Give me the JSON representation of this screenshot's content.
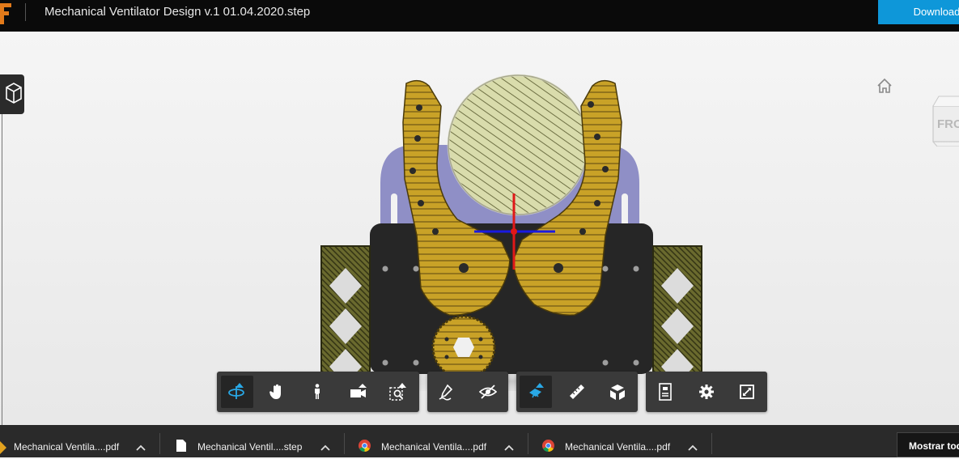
{
  "header": {
    "title": "Mechanical Ventilator Design v.1 01.04.2020.step",
    "download_label": "Download"
  },
  "viewport": {
    "viewcube_face": "FRONT",
    "background_color": "#efefef"
  },
  "toolbar": {
    "groups": [
      {
        "tools": [
          {
            "icon": "orbit-icon",
            "active": true,
            "has_menu": true
          },
          {
            "icon": "pan-hand-icon"
          },
          {
            "icon": "walk-person-icon"
          },
          {
            "icon": "camera-icon",
            "has_menu": true
          },
          {
            "icon": "zoom-window-icon",
            "has_menu": true
          }
        ]
      },
      {
        "tools": [
          {
            "icon": "markup-pen-icon"
          },
          {
            "icon": "hide-eye-icon"
          }
        ]
      },
      {
        "tools": [
          {
            "icon": "section-plane-icon",
            "active": true,
            "has_menu": true
          },
          {
            "icon": "measure-ruler-icon"
          },
          {
            "icon": "explode-model-icon"
          }
        ]
      },
      {
        "tools": [
          {
            "icon": "properties-icon"
          },
          {
            "icon": "settings-gear-icon"
          },
          {
            "icon": "fullscreen-icon"
          }
        ]
      }
    ],
    "accent_color": "#29a8e6"
  },
  "downloads_bar": {
    "items": [
      {
        "label": "Mechanical Ventila....pdf",
        "icon": "pdf-file-icon"
      },
      {
        "label": "Mechanical Ventil....step",
        "icon": "generic-file-icon"
      },
      {
        "label": "Mechanical Ventila....pdf",
        "icon": "chrome-icon"
      },
      {
        "label": "Mechanical Ventila....pdf",
        "icon": "chrome-icon"
      }
    ],
    "show_all_label": "Mostrar todo"
  },
  "colors": {
    "brand_orange": "#e27a1a",
    "download_blue": "#0e97d9",
    "gear_gold": "#c9a227",
    "extrusion_olive": "#5a5a26",
    "plate_black": "#262626",
    "frame_purple": "#8f8fc6",
    "disk_green": "#d9dcac"
  }
}
